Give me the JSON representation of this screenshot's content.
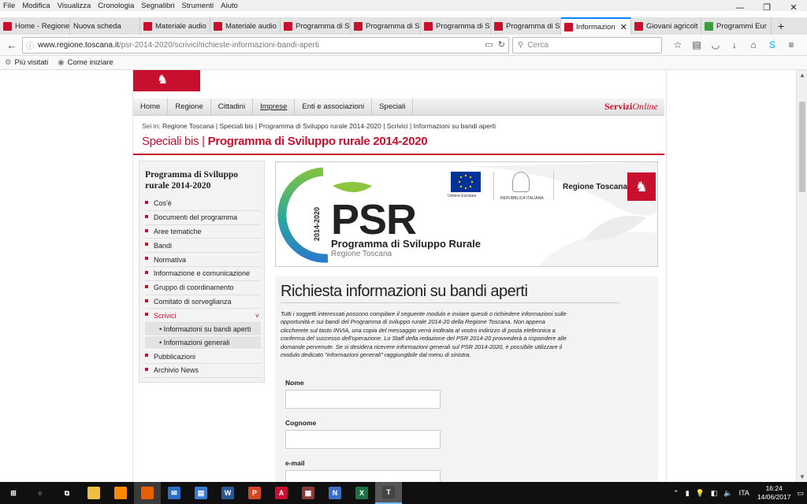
{
  "menubar": [
    "File",
    "Modifica",
    "Visualizza",
    "Cronologia",
    "Segnalibri",
    "Strumenti",
    "Aiuto"
  ],
  "window_controls": {
    "minimize": "—",
    "restore": "❐",
    "close": "✕"
  },
  "tabs": [
    {
      "label": "Home - Regione",
      "icon": "regione-toscana-favicon"
    },
    {
      "label": "Nuova scheda",
      "icon": "none"
    },
    {
      "label": "Materiale audio",
      "icon": "regione-toscana-favicon"
    },
    {
      "label": "Materiale audio",
      "icon": "regione-toscana-favicon"
    },
    {
      "label": "Programma di S",
      "icon": "regione-toscana-favicon"
    },
    {
      "label": "Programma di S",
      "icon": "regione-toscana-favicon"
    },
    {
      "label": "Programma di S",
      "icon": "regione-toscana-favicon"
    },
    {
      "label": "Programma di S",
      "icon": "regione-toscana-favicon"
    },
    {
      "label": "Informazion",
      "icon": "regione-toscana-favicon",
      "active": true
    },
    {
      "label": "Giovani agricolt",
      "icon": "regione-toscana-favicon"
    },
    {
      "label": "Programmi Eur",
      "icon": "green-favicon"
    }
  ],
  "new_tab_label": "+",
  "url": {
    "domain": "www.regione.toscana.it",
    "path": "/psr-2014-2020/scrivici/richieste-informazioni-bandi-aperti"
  },
  "search_placeholder": "Cerca",
  "bookmarks": [
    "Più visitati",
    "Come iniziare"
  ],
  "site": {
    "nav": [
      "Home",
      "Regione",
      "Cittadini",
      "Imprese",
      "Enti e associazioni",
      "Speciali"
    ],
    "servizi_bold": "Servizi",
    "servizi_italic": "Online",
    "breadcrumb_prefix": "Sei in:",
    "breadcrumb": "Regione Toscana | Speciali bis | Programma di Sviluppo rurale 2014-2020 | Scrivici | Informazioni su bandi aperti",
    "title_light": "Speciali bis |",
    "title_bold": "Programma di Sviluppo rurale 2014-2020"
  },
  "sidebar": {
    "title": "Programma di Sviluppo rurale 2014-2020",
    "items": [
      "Cos'è",
      "Documenti del programma",
      "Aree tematiche",
      "Bandi",
      "Normativa",
      "Informazione e comunicazione",
      "Gruppo di coordinamento",
      "Comitato di sorveglianza",
      "Scrivici"
    ],
    "active_item": "Scrivici",
    "chevron": "˅",
    "subitems": [
      "• Informazioni su bandi aperti",
      "• Informazioni generali"
    ],
    "items_after": [
      "Pubblicazioni",
      "Archivio News"
    ]
  },
  "banner": {
    "psr": "PSR",
    "year": "2014-2020",
    "subtitle": "Programma di Sviluppo Rurale",
    "region": "Regione Toscana",
    "eu_label": "Unione Europea",
    "rep_label": "REPUBBLICA ITALIANA",
    "rt_label": "Regione Toscana"
  },
  "content": {
    "title": "Richiesta informazioni su bandi aperti",
    "intro": "Tutti i soggetti interessati possono compilare il seguente modulo e inviare quesiti o richiedere informazioni sulle opportunità e sui bandi del Programma di sviluppo rurale 2014-20 della Regione Toscana. Non appena cliccherete sul tasto INVIA, una copia del messaggio verrà inoltrata al vostro indirizzo di posta elettronica a conferma del successo dell'operazione. Lo Staff della redazione del PSR 2014-20 provvederà a rispondere alle domande pervenute. Se si desidera ricevere informazioni generali sul PSR 2014-2020, è possibile utilizzare il modulo dedicato \"informazioni generali\" raggiungibile dal menu di sinistra.",
    "fields": [
      {
        "label": "Nome",
        "value": ""
      },
      {
        "label": "Cognome",
        "value": ""
      },
      {
        "label": "e-mail",
        "value": ""
      }
    ]
  },
  "taskbar": {
    "apps": [
      "start",
      "search",
      "task-view",
      "file-explorer",
      "vlc",
      "firefox",
      "thunderbird",
      "notepad",
      "word",
      "powerpoint",
      "acrobat",
      "winrar",
      "onenote",
      "excel",
      "text-app"
    ],
    "lang": "ITA",
    "time": "16:24",
    "date": "14/06/2017"
  },
  "colors": {
    "brand": "#c8102e",
    "active_tab_accent": "#0a84ff"
  }
}
